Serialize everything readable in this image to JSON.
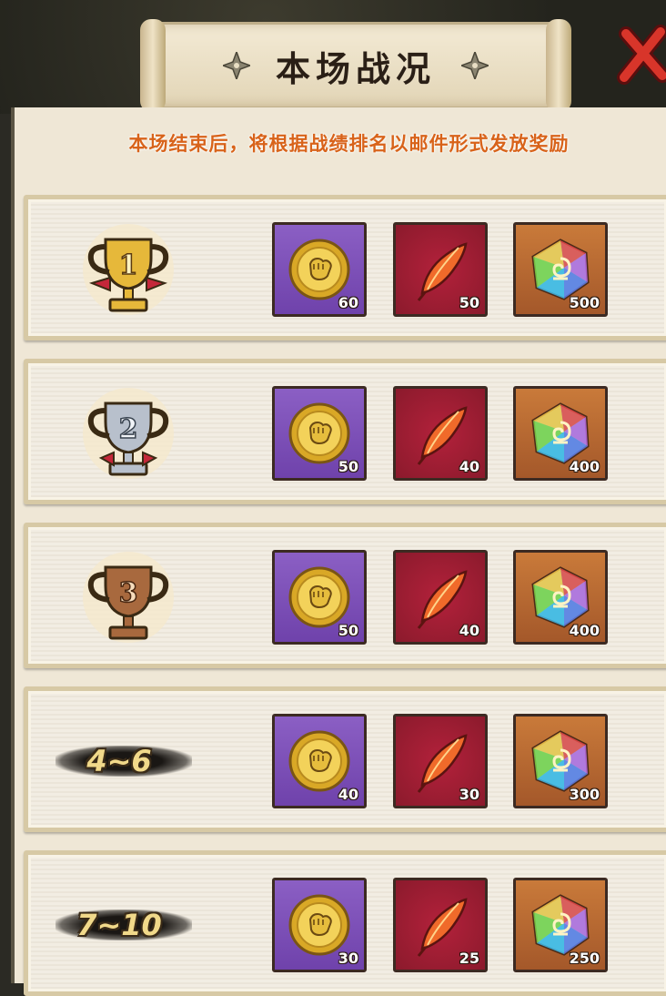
{
  "header": {
    "title": "本场战况"
  },
  "notice": "本场结束后，将根据战绩排名以邮件形式发放奖励",
  "colors": {
    "coin_bg": "#7b4fb8",
    "feather_bg": "#a11f36",
    "gem_bg": "#b86a32",
    "notice": "#d8631a",
    "gold_trophy": "#e6b83a",
    "silver_trophy": "#b8c0cc",
    "bronze_trophy": "#a8693e"
  },
  "rows": [
    {
      "rank": "1",
      "trophy": "gold",
      "rewards": {
        "coin": "60",
        "feather": "50",
        "gem": "500"
      }
    },
    {
      "rank": "2",
      "trophy": "silver",
      "rewards": {
        "coin": "50",
        "feather": "40",
        "gem": "400"
      }
    },
    {
      "rank": "3",
      "trophy": "bronze",
      "rewards": {
        "coin": "50",
        "feather": "40",
        "gem": "400"
      }
    },
    {
      "rank": "4~6",
      "trophy": "none",
      "rewards": {
        "coin": "40",
        "feather": "30",
        "gem": "300"
      }
    },
    {
      "rank": "7~10",
      "trophy": "none",
      "rewards": {
        "coin": "30",
        "feather": "25",
        "gem": "250"
      }
    }
  ],
  "icons": [
    "shuriken-icon",
    "close-icon",
    "trophy-icon",
    "coin-icon",
    "feather-icon",
    "gem-icon"
  ]
}
